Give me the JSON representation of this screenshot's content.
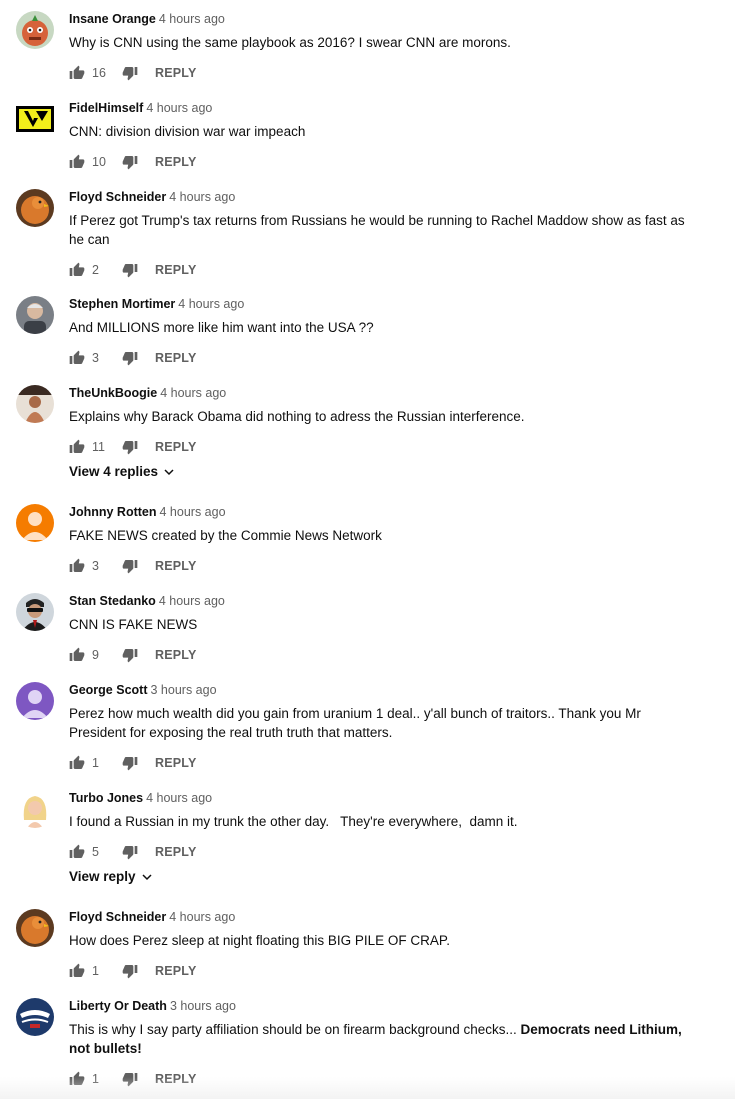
{
  "comments": [
    {
      "author": "Insane Orange",
      "time": "4 hours ago",
      "text": "Why is CNN using the same playbook as 2016? I swear CNN are morons.",
      "likes": "16",
      "reply_label": "REPLY",
      "avatar": "orange-cartoon-avatar"
    },
    {
      "author": "FidelHimself",
      "time": "4 hours ago",
      "text": "CNN: division division war war impeach",
      "likes": "10",
      "reply_label": "REPLY",
      "avatar": "yellow-logo-avatar"
    },
    {
      "author": "Floyd Schneider",
      "time": "4 hours ago",
      "text": "If Perez got Trump's tax returns from Russians he would be running to Rachel Maddow show as fast as he can",
      "likes": "2",
      "reply_label": "REPLY",
      "avatar": "orange-chicken-avatar"
    },
    {
      "author": "Stephen Mortimer",
      "time": "4 hours ago",
      "text": "And MILLIONS more like him want into the USA ??",
      "likes": "3",
      "reply_label": "REPLY",
      "avatar": "man-photo-avatar"
    },
    {
      "author": "TheUnkBoogie",
      "time": "4 hours ago",
      "text": "Explains why Barack Obama did nothing to adress the Russian interference.",
      "likes": "11",
      "reply_label": "REPLY",
      "view_replies": "View 4 replies",
      "avatar": "figure-photo-avatar"
    },
    {
      "author": "Johnny Rotten",
      "time": "4 hours ago",
      "text": "FAKE NEWS created by the Commie News Network",
      "likes": "3",
      "reply_label": "REPLY",
      "avatar": "default-orange-avatar"
    },
    {
      "author": "Stan Stedanko",
      "time": "4 hours ago",
      "text": "CNN IS FAKE NEWS",
      "likes": "9",
      "reply_label": "REPLY",
      "avatar": "man-sunglasses-avatar"
    },
    {
      "author": "George Scott",
      "time": "3 hours ago",
      "text": "Perez how much wealth did you gain from uranium 1 deal.. y'all bunch of traitors.. Thank you Mr President for exposing the real truth truth that matters.",
      "likes": "1",
      "reply_label": "REPLY",
      "avatar": "default-purple-avatar"
    },
    {
      "author": "Turbo Jones",
      "time": "4 hours ago",
      "text": "I found a Russian in my trunk the other day.   They're everywhere,  damn it.",
      "likes": "5",
      "reply_label": "REPLY",
      "view_replies": "View reply",
      "avatar": "blonde-woman-avatar"
    },
    {
      "author": "Floyd Schneider",
      "time": "4 hours ago",
      "text": "How does Perez sleep at night floating this BIG PILE OF CRAP.",
      "likes": "1",
      "reply_label": "REPLY",
      "avatar": "orange-chicken-avatar"
    },
    {
      "author": "Liberty Or Death",
      "time": "3 hours ago",
      "text": "This is why I say party affiliation should be on firearm background checks... ",
      "text_bold": "Democrats need Lithium, not bullets!",
      "likes": "1",
      "reply_label": "REPLY",
      "avatar": "trump-45-logo-avatar"
    }
  ],
  "icons": {
    "like": "thumbs-up-icon",
    "dislike": "thumbs-down-icon",
    "expand": "chevron-down-icon"
  },
  "colors": {
    "text": "#0f0f0f",
    "meta": "#606060",
    "default_orange": "#f57c00",
    "default_purple": "#7e57c2"
  }
}
